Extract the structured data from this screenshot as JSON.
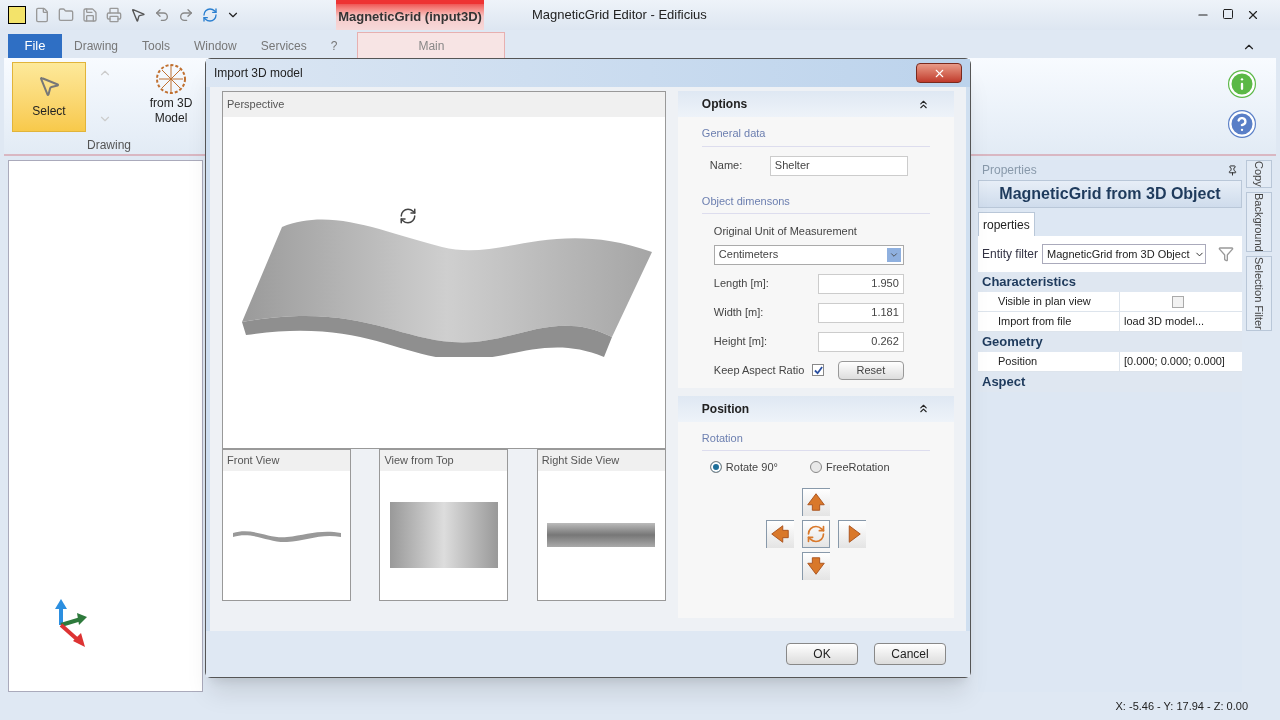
{
  "window": {
    "title": "MagneticGrid Editor - Edificius"
  },
  "file_tab": "File",
  "tabs": [
    {
      "label": "Drawing",
      "selected": false
    },
    {
      "label": "Tools",
      "selected": false
    },
    {
      "label": "Window",
      "selected": false
    },
    {
      "label": "Services",
      "selected": false
    },
    {
      "label": "?",
      "selected": false
    }
  ],
  "context_tab": {
    "group": "MagneticGrid (input3D)",
    "label": "Main",
    "selected": true
  },
  "ribbon": {
    "select": "Select",
    "from_model": [
      "from 3D",
      "Model"
    ],
    "group": "Drawing"
  },
  "properties": {
    "title": "Properties",
    "heading": "MagneticGrid from 3D Object",
    "tab": "roperties",
    "filter_label": "Entity filter",
    "filter_value": "MagneticGrid from 3D Object",
    "categories": [
      {
        "name": "Characteristics",
        "rows": [
          {
            "label": "Visible in plan view",
            "kind": "checkbox",
            "checked": false
          },
          {
            "label": "Import from file",
            "kind": "text",
            "value": "load 3D model..."
          }
        ]
      },
      {
        "name": "Geometry",
        "rows": [
          {
            "label": "Position",
            "kind": "text",
            "value": "[0.000; 0.000; 0.000]"
          }
        ]
      },
      {
        "name": "Aspect"
      }
    ]
  },
  "side_tabs": [
    "Copy",
    "Background",
    "Selection Filter"
  ],
  "status_bar": "X: -5.46 - Y: 17.94 - Z: 0.00",
  "dialog": {
    "title": "Import 3D model",
    "perspective": "Perspective",
    "views": [
      "Front View",
      "View from Top",
      "Right Side View"
    ],
    "options": {
      "heading": "Options",
      "general": "General data",
      "name_label": "Name:",
      "name": "Shelter",
      "dimensions": "Object dimensons",
      "unit_label": "Original Unit of Measurement",
      "unit": "Centimeters",
      "dims": [
        {
          "label": "Length [m]:",
          "value": "1.950"
        },
        {
          "label": "Width [m]:",
          "value": "1.181"
        },
        {
          "label": "Height [m]:",
          "value": "0.262"
        }
      ],
      "keep_label": "Keep Aspect Ratio",
      "keep_checked": true,
      "reset": "Reset"
    },
    "position": {
      "heading": "Position",
      "rotation": "Rotation",
      "radios": [
        {
          "label": "Rotate 90°",
          "selected": true
        },
        {
          "label": "FreeRotation",
          "selected": false
        }
      ]
    },
    "buttons": [
      "OK",
      "Cancel"
    ]
  }
}
